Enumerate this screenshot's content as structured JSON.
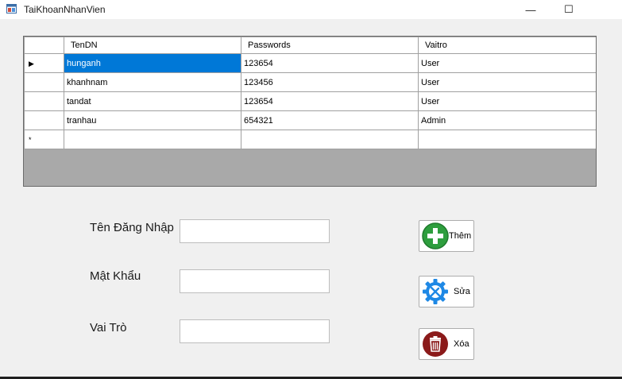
{
  "window": {
    "title": "TaiKhoanNhanVien",
    "minimize_glyph": "—",
    "maximize_glyph": "☐"
  },
  "grid": {
    "columns": [
      "TenDN",
      "Passwords",
      "Vaitro"
    ],
    "rows": [
      [
        "hunganh",
        "123654",
        "User"
      ],
      [
        "khanhnam",
        "123456",
        "User"
      ],
      [
        "tandat",
        "123654",
        "User"
      ],
      [
        "tranhau",
        "654321",
        "Admin"
      ]
    ],
    "current_row_glyph": "▶",
    "new_row_glyph": "*"
  },
  "form": {
    "username_label": "Tên Đăng Nhập",
    "password_label": "Mật Khẩu",
    "role_label": "Vai Trò",
    "username_value": "",
    "password_value": "",
    "role_value": ""
  },
  "buttons": {
    "add_label": "Thêm",
    "edit_label": "Sửa",
    "delete_label": "Xóa"
  },
  "colors": {
    "selection": "#0078d7",
    "add_icon": "#2e9e3e",
    "edit_icon": "#1e88e5",
    "delete_icon": "#8b1a1a"
  }
}
